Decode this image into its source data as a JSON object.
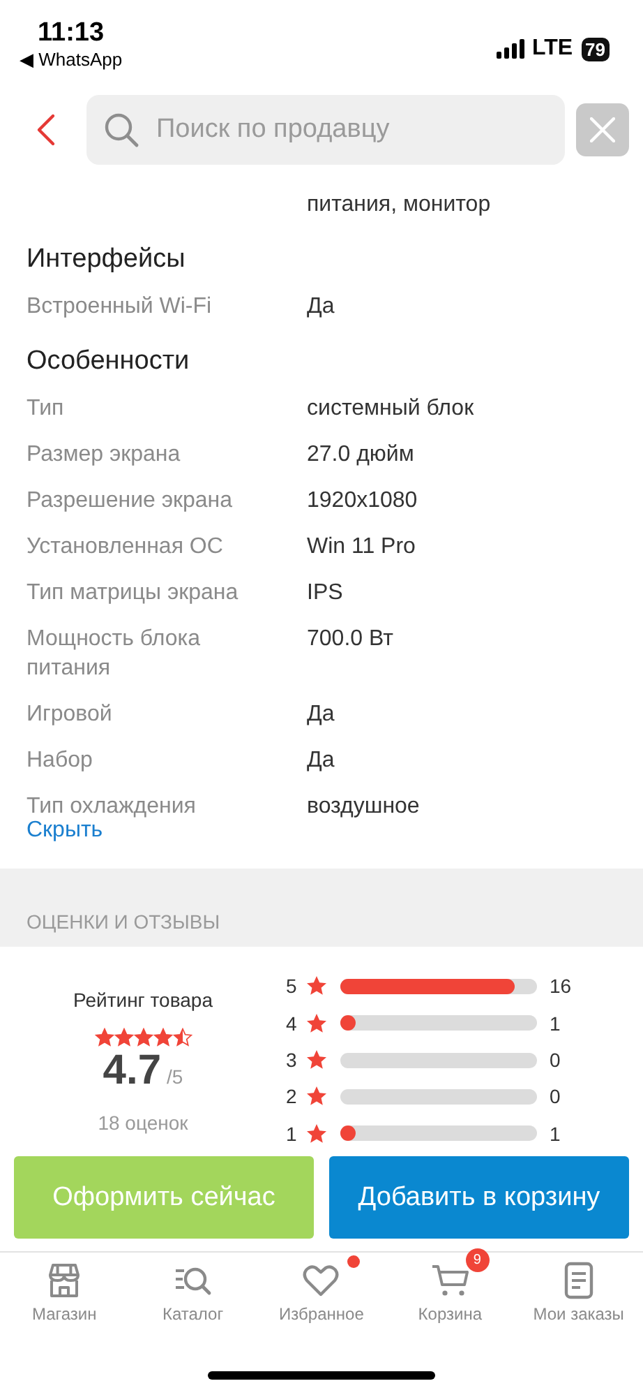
{
  "status_bar": {
    "time": "11:13",
    "back_app": "◀ WhatsApp",
    "network": "LTE",
    "battery": "79"
  },
  "header": {
    "search": {
      "placeholder": "Поиск по продавцу"
    }
  },
  "spec_continuation": "питания, монитор",
  "spec_sections": [
    {
      "title": "Интерфейсы",
      "rows": [
        {
          "label": "Встроенный Wi-Fi",
          "value": "Да"
        }
      ]
    },
    {
      "title": "Особенности",
      "rows": [
        {
          "label": "Тип",
          "value": "системный блок"
        },
        {
          "label": "Размер экрана",
          "value": "27.0 дюйм"
        },
        {
          "label": "Разрешение экрана",
          "value": "1920x1080"
        },
        {
          "label": "Установленная ОС",
          "value": "Win 11 Pro"
        },
        {
          "label": "Тип матрицы экрана",
          "value": "IPS"
        },
        {
          "label": "Мощность блока питания",
          "value": "700.0 Вт"
        },
        {
          "label": "Игровой",
          "value": "Да"
        },
        {
          "label": "Набор",
          "value": "Да"
        },
        {
          "label": "Тип охлаждения",
          "value": "воздушное"
        }
      ]
    }
  ],
  "hide_link": "Скрыть",
  "reviews": {
    "heading": "ОЦЕНКИ И ОТЗЫВЫ",
    "rating_label": "Рейтинг товара",
    "stars": 4.5,
    "score": "4.7",
    "out_of": "/5",
    "count": "18 оценок",
    "breakdown": [
      {
        "grade": "5",
        "level": 0.89,
        "count": "16"
      },
      {
        "grade": "4",
        "level": 0.06,
        "count": "1"
      },
      {
        "grade": "3",
        "count": "0"
      },
      {
        "grade": "2",
        "count": "0"
      },
      {
        "grade": "1",
        "level": 0.06,
        "count": "1"
      }
    ]
  },
  "actions": [
    {
      "label": "Оформить сейчас",
      "kind": "primary-green"
    },
    {
      "label": "Добавить в корзину",
      "kind": "primary-blue"
    }
  ],
  "tab_bar": [
    {
      "kind": "shop",
      "label": "Магазин",
      "dot": false
    },
    {
      "kind": "catalog",
      "label": "Каталог",
      "dot": false
    },
    {
      "kind": "favorites",
      "label": "Избранное",
      "dot": true
    },
    {
      "kind": "cart",
      "label": "Корзина",
      "dot": false,
      "badge": "9"
    },
    {
      "kind": "orders",
      "label": "Мои заказы",
      "dot": false
    }
  ]
}
